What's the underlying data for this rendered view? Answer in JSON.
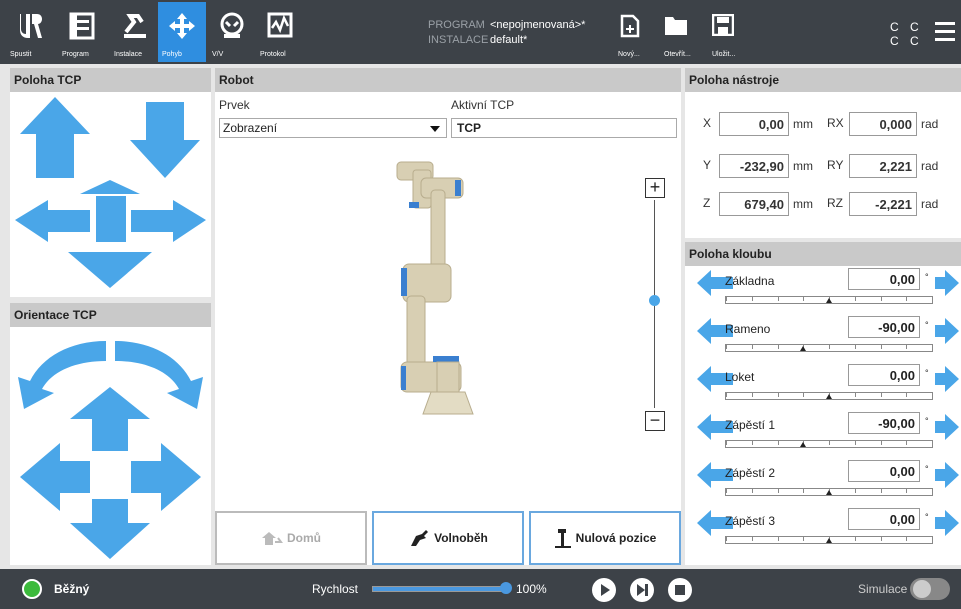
{
  "nav": [
    {
      "label": "Spustit",
      "icon": "ur-logo-icon"
    },
    {
      "label": "Program",
      "icon": "program-icon"
    },
    {
      "label": "Instalace",
      "icon": "installation-icon"
    },
    {
      "label": "Pohyb",
      "icon": "move-icon",
      "active": true
    },
    {
      "label": "V/V",
      "icon": "io-icon"
    },
    {
      "label": "Protokol",
      "icon": "log-icon"
    }
  ],
  "program": {
    "key": "PROGRAM",
    "value": "<nepojmenovaná>*"
  },
  "installation": {
    "key": "INSTALACE",
    "value": "default*"
  },
  "file_buttons": {
    "new": "Nový...",
    "open": "Otevřít...",
    "save": "Uložit..."
  },
  "cc": {
    "line1": "C C",
    "line2": "C C"
  },
  "panels": {
    "poloha_tcp": "Poloha TCP",
    "orientace_tcp": "Orientace TCP",
    "robot": "Robot",
    "poloha_nastroje": "Poloha nástroje",
    "poloha_kloubu": "Poloha kloubu"
  },
  "robot": {
    "prvek_label": "Prvek",
    "prvek_value": "Zobrazení",
    "tcp_label": "Aktivní TCP",
    "tcp_value": "TCP",
    "zoom_in": "+",
    "zoom_out": "−",
    "btn_home": "Domů",
    "btn_freedrive": "Volnoběh",
    "btn_zero": "Nulová pozice"
  },
  "tool": {
    "x": {
      "label": "X",
      "value": "0,00",
      "unit": "mm"
    },
    "y": {
      "label": "Y",
      "value": "-232,90",
      "unit": "mm"
    },
    "z": {
      "label": "Z",
      "value": "679,40",
      "unit": "mm"
    },
    "rx": {
      "label": "RX",
      "value": "0,000",
      "unit": "rad"
    },
    "ry": {
      "label": "RY",
      "value": "2,221",
      "unit": "rad"
    },
    "rz": {
      "label": "RZ",
      "value": "-2,221",
      "unit": "rad"
    }
  },
  "joints": [
    {
      "name": "Základna",
      "value": "0,00",
      "unit": "°",
      "position": 0.5
    },
    {
      "name": "Rameno",
      "value": "-90,00",
      "unit": "°",
      "position": 0.375
    },
    {
      "name": "Loket",
      "value": "0,00",
      "unit": "°",
      "position": 0.5
    },
    {
      "name": "Zápěstí 1",
      "value": "-90,00",
      "unit": "°",
      "position": 0.375
    },
    {
      "name": "Zápěstí 2",
      "value": "0,00",
      "unit": "°",
      "position": 0.5
    },
    {
      "name": "Zápěstí 3",
      "value": "0,00",
      "unit": "°",
      "position": 0.5
    }
  ],
  "footer": {
    "status": "Běžný",
    "speed_label": "Rychlost",
    "speed_value": "100%",
    "speed_fraction": 1.0,
    "simulation_label": "Simulace"
  },
  "colors": {
    "accent": "#4aa6e8",
    "topbar": "#3d4248",
    "status_ok": "#3cba3c"
  }
}
